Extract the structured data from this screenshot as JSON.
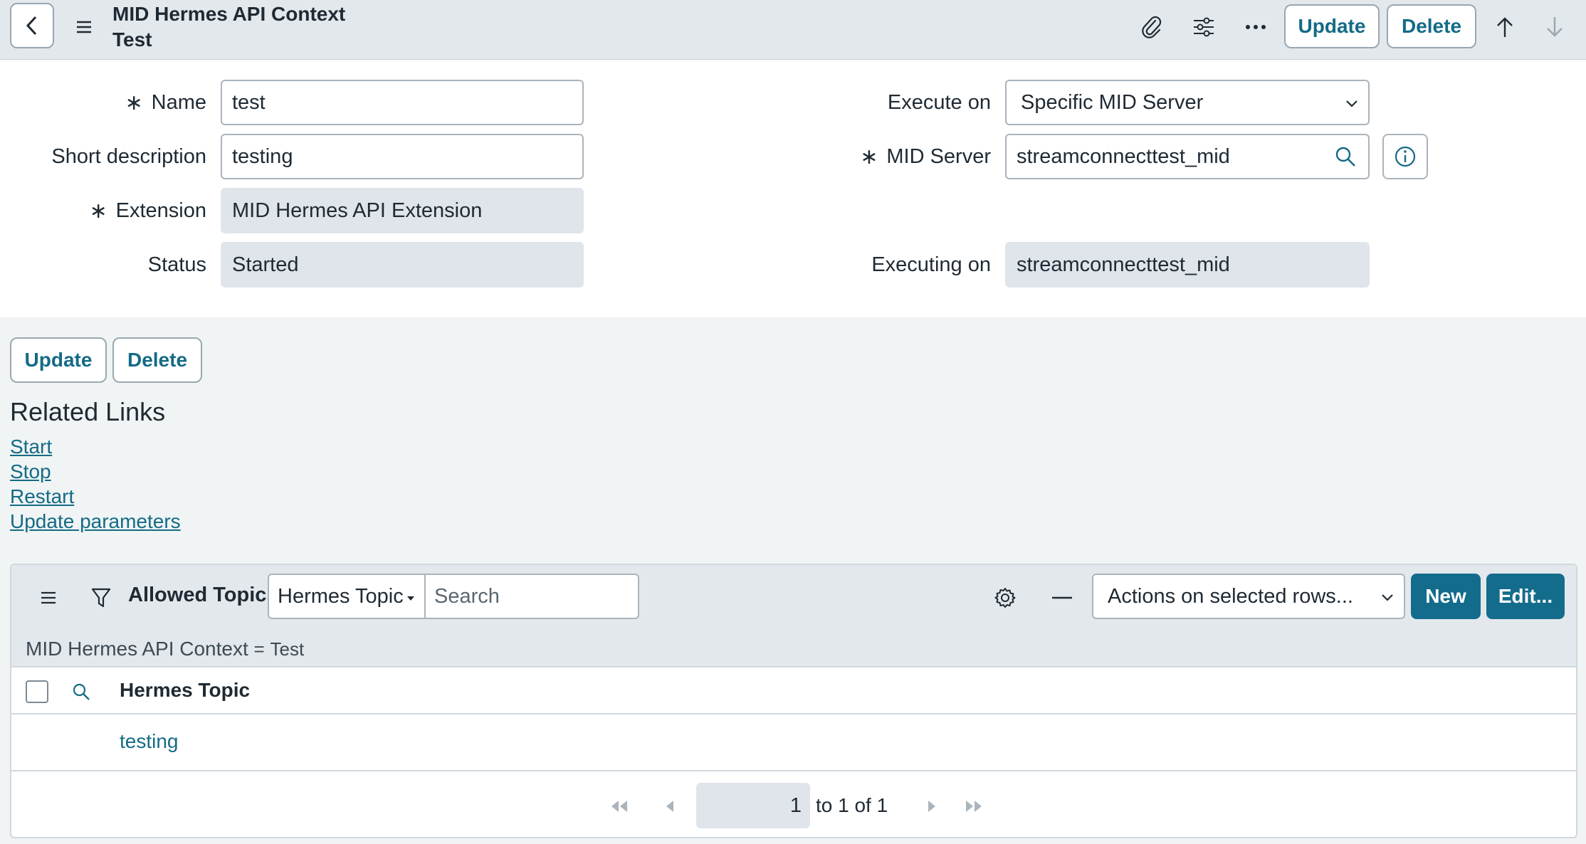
{
  "header": {
    "title_line1": "MID Hermes API Context",
    "title_line2": "Test",
    "update_label": "Update",
    "delete_label": "Delete"
  },
  "form": {
    "name_label": "Name",
    "name_value": "test",
    "short_desc_label": "Short description",
    "short_desc_value": "testing",
    "extension_label": "Extension",
    "extension_value": "MID Hermes API Extension",
    "status_label": "Status",
    "status_value": "Started",
    "execute_on_label": "Execute on",
    "execute_on_value": "Specific MID Server",
    "mid_server_label": "MID Server",
    "mid_server_value": "streamconnecttest_mid",
    "executing_on_label": "Executing on",
    "executing_on_value": "streamconnecttest_mid",
    "required_marker": "∗"
  },
  "actions": {
    "update_label": "Update",
    "delete_label": "Delete"
  },
  "related_links": {
    "title": "Related Links",
    "links": [
      "Start",
      "Stop",
      "Restart",
      "Update parameters"
    ]
  },
  "related_list": {
    "title": "Allowed Topics",
    "search_field_select": "Hermes Topic",
    "search_placeholder": "Search",
    "actions_select": "Actions on selected rows...",
    "new_label": "New",
    "edit_label": "Edit...",
    "filter_field": "MID Hermes API Context",
    "filter_operator": "=",
    "filter_value": "Test",
    "column_header": "Hermes Topic",
    "rows": [
      "testing"
    ],
    "pager_current": "1",
    "pager_text": "to 1 of 1"
  },
  "colors": {
    "accent": "#136c8c",
    "link": "#146b86",
    "header_bg": "#e3e8ec"
  }
}
